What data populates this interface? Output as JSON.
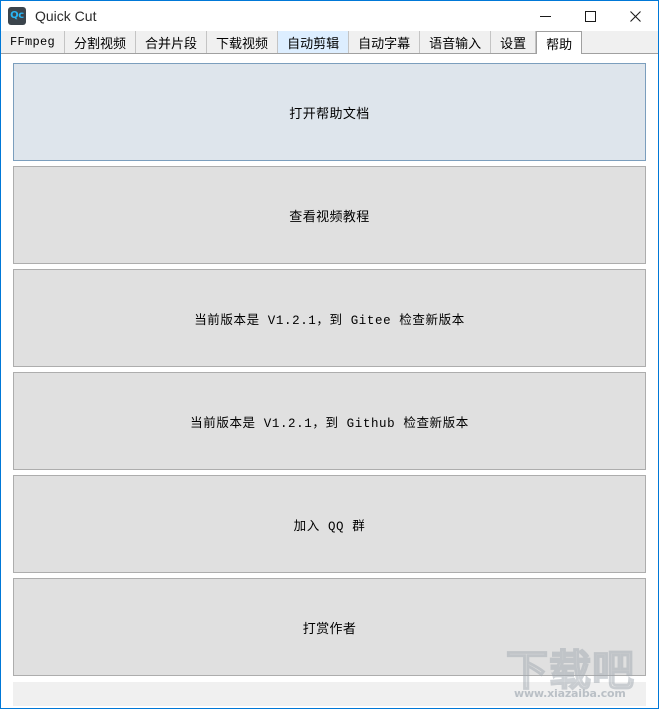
{
  "window": {
    "title": "Quick Cut",
    "icon_label": "Qc",
    "accent_color": "#0078d7",
    "icon_bg_color": "#3b444c",
    "icon_text_color": "#29b6f6",
    "controls": {
      "minimize": "minimize-icon",
      "maximize": "maximize-icon",
      "close": "close-icon"
    }
  },
  "tabs": [
    {
      "label": "FFmpeg",
      "state": "normal",
      "mono": true
    },
    {
      "label": "分割视频",
      "state": "normal",
      "mono": false
    },
    {
      "label": "合并片段",
      "state": "normal",
      "mono": false
    },
    {
      "label": "下载视频",
      "state": "normal",
      "mono": false
    },
    {
      "label": "自动剪辑",
      "state": "hover",
      "mono": false
    },
    {
      "label": "自动字幕",
      "state": "normal",
      "mono": false
    },
    {
      "label": "语音输入",
      "state": "normal",
      "mono": false
    },
    {
      "label": "设置",
      "state": "normal",
      "mono": false
    },
    {
      "label": "帮助",
      "state": "active",
      "mono": false
    }
  ],
  "buttons": [
    {
      "label": "打开帮助文档",
      "state": "focused",
      "mono": false
    },
    {
      "label": "查看视频教程",
      "state": "normal",
      "mono": false
    },
    {
      "label": "当前版本是 V1.2.1，到 Gitee 检查新版本",
      "state": "normal",
      "mono": true
    },
    {
      "label": "当前版本是 V1.2.1，到 Github 检查新版本",
      "state": "normal",
      "mono": true
    },
    {
      "label": "加入 QQ 群",
      "state": "normal",
      "mono": true
    },
    {
      "label": "打赏作者",
      "state": "normal",
      "mono": false
    }
  ],
  "watermark": {
    "text": "下载吧",
    "url": "www.xiazaiba.com"
  }
}
